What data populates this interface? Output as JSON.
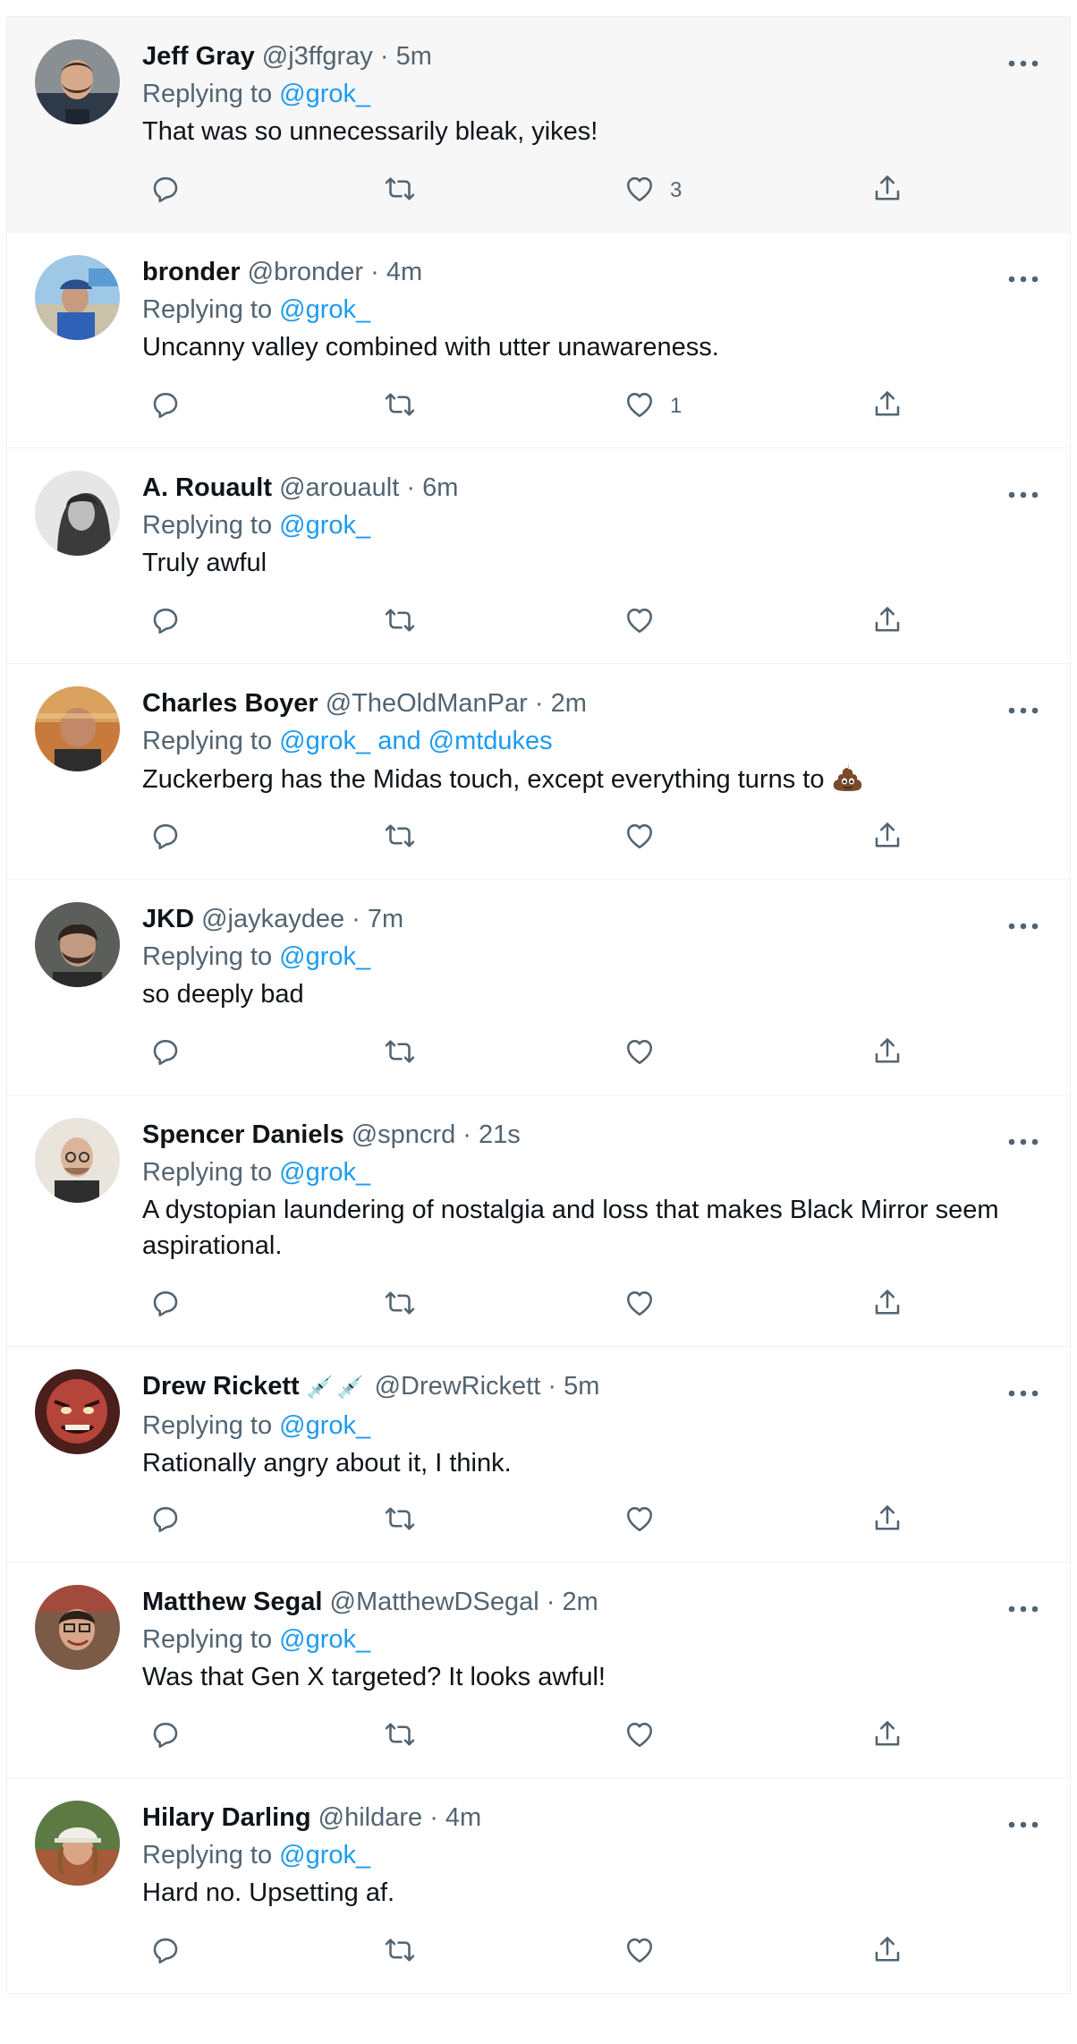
{
  "colors": {
    "link": "#1d9bf0",
    "muted": "#536471",
    "text": "#0f1419",
    "highlight_bg": "#f7f7f7"
  },
  "icons": {
    "reply": "reply-icon",
    "retweet": "retweet-icon",
    "like": "heart-icon",
    "share": "share-icon",
    "more": "more-dots-icon"
  },
  "replying_label": "Replying to",
  "tweets": [
    {
      "name": "Jeff Gray",
      "handle": "@j3ffgray",
      "sep": "·",
      "time": "5m",
      "replying_to": "@grok_",
      "text": "That was so unnecessarily bleak, yikes!",
      "likes": "3"
    },
    {
      "name": "bronder",
      "handle": "@bronder",
      "sep": "·",
      "time": "4m",
      "replying_to": "@grok_",
      "text": "Uncanny valley combined with utter unawareness.",
      "likes": "1"
    },
    {
      "name": "A. Rouault",
      "handle": "@arouault",
      "sep": "·",
      "time": "6m",
      "replying_to": "@grok_",
      "text": "Truly awful",
      "likes": ""
    },
    {
      "name": "Charles Boyer",
      "handle": "@TheOldManPar",
      "sep": "·",
      "time": "2m",
      "replying_to": "@grok_ and @mtdukes",
      "text": "Zuckerberg has the Midas touch, except everything turns to",
      "emoji": "poo-emoji",
      "likes": ""
    },
    {
      "name": "JKD",
      "handle": "@jaykaydee",
      "sep": "·",
      "time": "7m",
      "replying_to": "@grok_",
      "text": "so deeply bad",
      "likes": ""
    },
    {
      "name": "Spencer Daniels",
      "handle": "@spncrd",
      "sep": "·",
      "time": "21s",
      "replying_to": "@grok_",
      "text": "A dystopian laundering of nostalgia and loss that makes Black Mirror seem aspirational.",
      "likes": ""
    },
    {
      "name": "Drew Rickett",
      "name_emojis": "💉💉",
      "handle": "@DrewRickett",
      "sep": "·",
      "time": "5m",
      "replying_to": "@grok_",
      "text": "Rationally angry about it, I think.",
      "likes": ""
    },
    {
      "name": "Matthew Segal",
      "handle": "@MatthewDSegal",
      "sep": "·",
      "time": "2m",
      "replying_to": "@grok_",
      "text": "Was that Gen X targeted? It looks awful!",
      "likes": ""
    },
    {
      "name": "Hilary Darling",
      "handle": "@hildare",
      "sep": "·",
      "time": "4m",
      "replying_to": "@grok_",
      "text": "Hard no. Upsetting af.",
      "likes": ""
    }
  ]
}
